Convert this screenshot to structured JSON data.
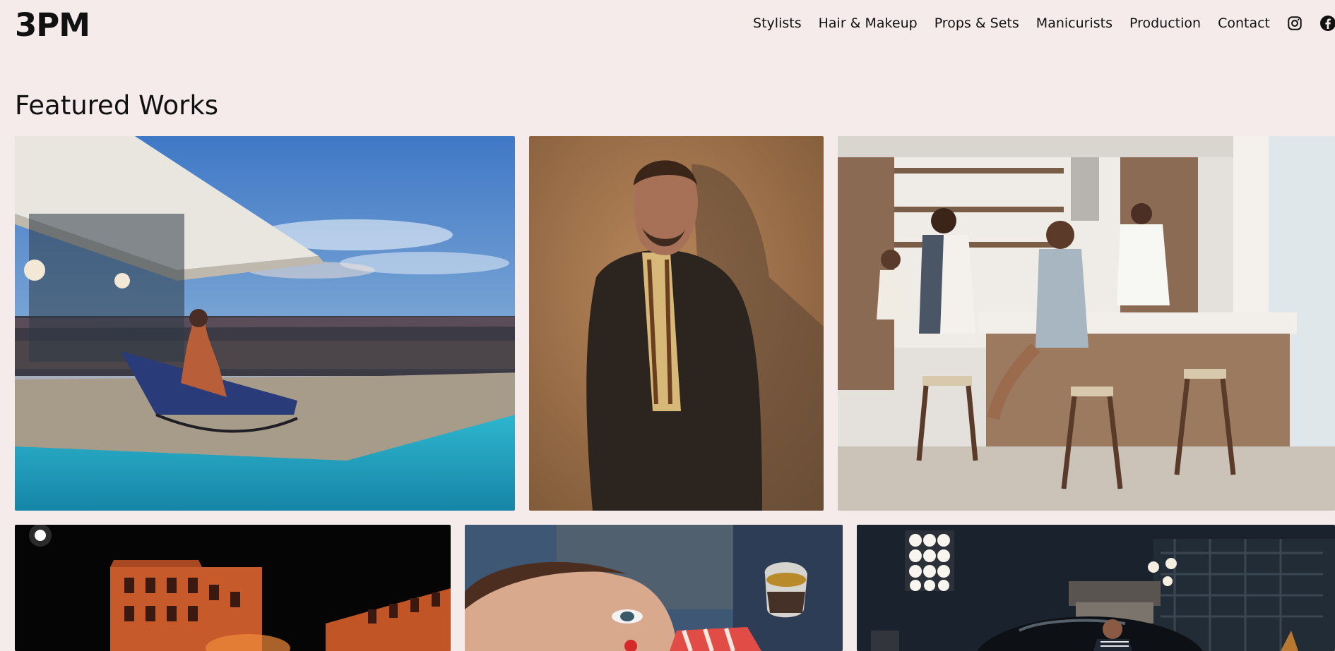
{
  "brand": {
    "logo": "3PM"
  },
  "nav": {
    "items": [
      {
        "label": "Stylists"
      },
      {
        "label": "Hair & Makeup"
      },
      {
        "label": "Props & Sets"
      },
      {
        "label": "Manicurists"
      },
      {
        "label": "Production"
      },
      {
        "label": "Contact"
      }
    ],
    "social": [
      "instagram-icon",
      "facebook-icon"
    ]
  },
  "featured": {
    "title": "Featured Works",
    "works": [
      {
        "subject": "poolside-lounge"
      },
      {
        "subject": "man-leather-jacket-portrait"
      },
      {
        "subject": "family-kitchen-chef"
      },
      {
        "subject": "night-building-street"
      },
      {
        "subject": "woman-espresso-closeup"
      },
      {
        "subject": "studio-lights-car"
      }
    ]
  },
  "colors": {
    "background": "#f4ebea",
    "text": "#111111"
  }
}
